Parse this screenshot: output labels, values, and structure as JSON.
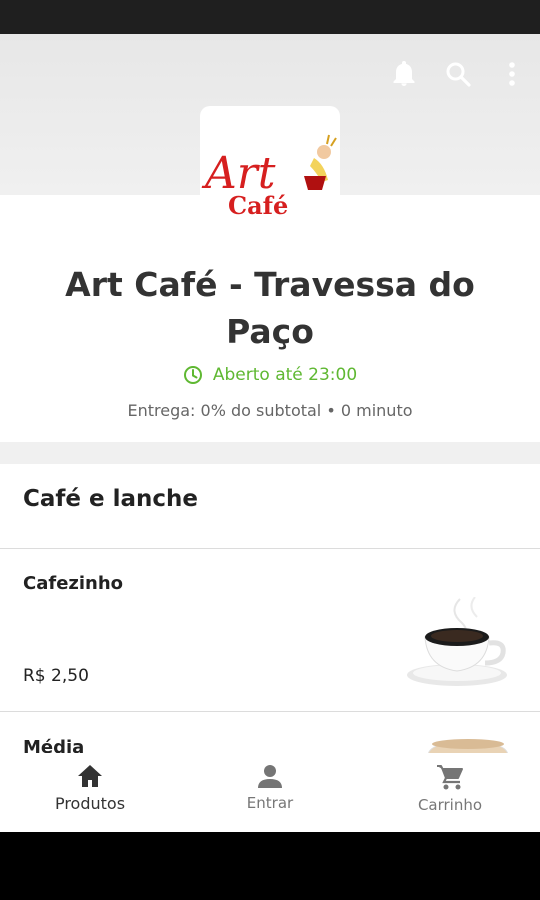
{
  "store": {
    "name": "Art Café - Travessa do Paço",
    "status": "Aberto até 23:00",
    "delivery": "Entrega: 0% do subtotal • 0 minuto",
    "logo_text_top": "Art",
    "logo_text_bottom": "Café"
  },
  "header": {
    "icons": [
      "bell-icon",
      "search-icon",
      "more-vert-icon"
    ]
  },
  "category": {
    "title": "Café e lanche"
  },
  "products": [
    {
      "name": "Cafezinho",
      "price": "R$ 2,50"
    },
    {
      "name": "Média",
      "price": ""
    }
  ],
  "bottom_nav": {
    "items": [
      {
        "label": "Produtos",
        "icon": "home-icon",
        "active": true
      },
      {
        "label": "Entrar",
        "icon": "person-icon",
        "active": false
      },
      {
        "label": "Carrinho",
        "icon": "cart-icon",
        "active": false
      }
    ]
  },
  "colors": {
    "open_green": "#5fb832",
    "logo_red": "#d61f1f"
  }
}
